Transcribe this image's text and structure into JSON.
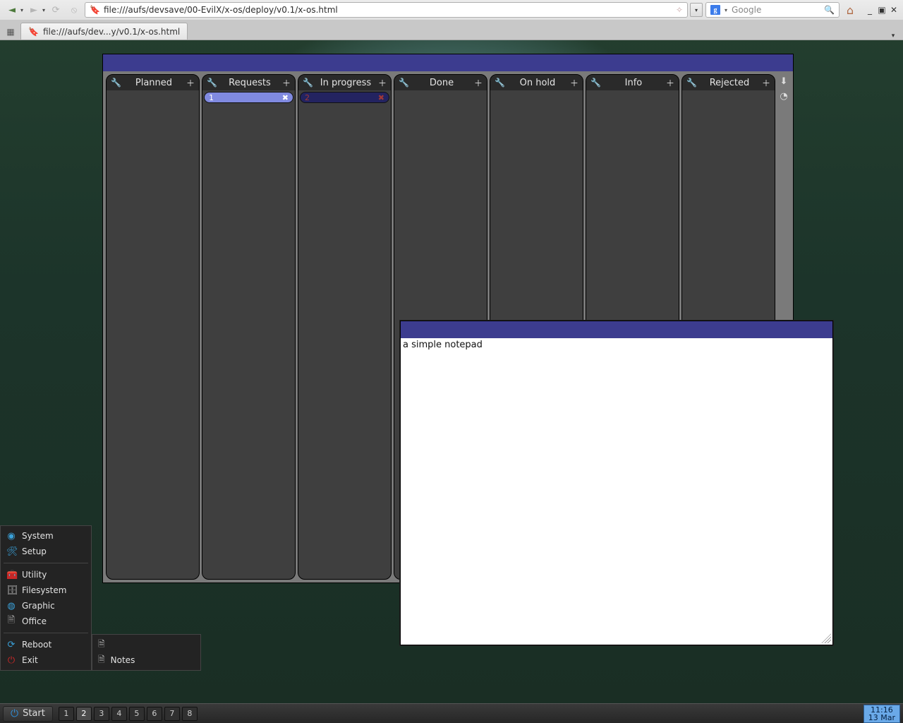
{
  "browser": {
    "url": "file:///aufs/devsave/00-EvilX/x-os/deploy/v0.1/x-os.html",
    "tab_title": "file:///aufs/dev...y/v0.1/x-os.html",
    "search_placeholder": "Google"
  },
  "kanban": {
    "columns": [
      {
        "title": "Planned",
        "cards": []
      },
      {
        "title": "Requests",
        "cards": [
          {
            "label": "1",
            "selected": true
          }
        ]
      },
      {
        "title": "In progress",
        "cards": [
          {
            "label": "2",
            "selected": false
          }
        ]
      },
      {
        "title": "Done",
        "cards": []
      },
      {
        "title": "On hold",
        "cards": []
      },
      {
        "title": "Info",
        "cards": []
      },
      {
        "title": "Rejected",
        "cards": []
      }
    ]
  },
  "notepad": {
    "content": "a simple notepad"
  },
  "start_menu": {
    "top": [
      "System",
      "Setup"
    ],
    "middle": [
      "Utility",
      "Filesystem",
      "Graphic",
      "Office"
    ],
    "bottom": [
      "Reboot",
      "Exit"
    ]
  },
  "submenu": {
    "items": [
      "",
      "Notes"
    ]
  },
  "taskbar": {
    "start_label": "Start",
    "pages": [
      "1",
      "2",
      "3",
      "4",
      "5",
      "6",
      "7",
      "8"
    ],
    "active_page": 1,
    "clock_time": "11:16",
    "clock_date": "13 Mar"
  }
}
